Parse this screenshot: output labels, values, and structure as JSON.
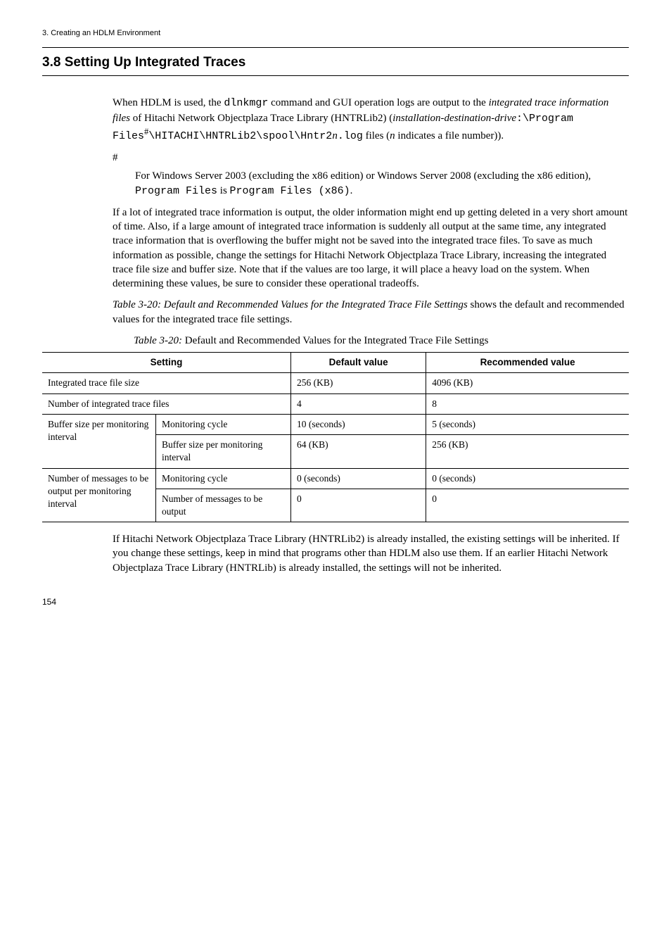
{
  "header": {
    "chapter": "3.  Creating an HDLM Environment"
  },
  "section": {
    "title": "3.8  Setting Up Integrated Traces"
  },
  "intro": {
    "p1_a": "When HDLM is used, the ",
    "p1_cmd": "dlnkmgr",
    "p1_b": " command and GUI operation logs are output to the ",
    "p1_italic1": "integrated trace information files",
    "p1_c": " of Hitachi Network Objectplaza Trace Library (HNTRLib2) (",
    "p1_italic2": "installation-destination-drive",
    "p1_mono1": ":\\Program",
    "p2_mono_prefix": "Files",
    "p2_hash": "#",
    "p2_mono_path_a": "\\HITACHI\\HNTRLib2\\spool\\Hntr2",
    "p2_n": "n",
    "p2_mono_path_b": ".log",
    "p2_d": " files (",
    "p2_italic3": "n",
    "p2_e": " indicates a file number)).",
    "hash": "#",
    "note_a": "For Windows Server 2003 (excluding the x86 edition) or Windows Server 2008 (excluding the x86 edition), ",
    "note_mono1": "Program Files",
    "note_b": " is ",
    "note_mono2": "Program Files (x86)",
    "note_c": "."
  },
  "body": {
    "para1": "If a lot of integrated trace information is output, the older information might end up getting deleted in a very short amount of time. Also, if a large amount of integrated trace information is suddenly all output at the same time, any integrated trace information that is overflowing the buffer might not be saved into the integrated trace files. To save as much information as possible, change the settings for Hitachi Network Objectplaza Trace Library, increasing the integrated trace file size and buffer size. Note that if the values are too large, it will place a heavy load on the system. When determining these values, be sure to consider these operational tradeoffs.",
    "para2_ref": "Table  3-20:  Default and Recommended Values for the Integrated Trace File Settings",
    "para2_tail": " shows the default and recommended values for the integrated trace file settings."
  },
  "table": {
    "caption_ref": "Table  3-20:",
    "caption_text": "  Default and Recommended Values for the Integrated Trace File Settings",
    "headers": {
      "setting": "Setting",
      "default": "Default value",
      "recommended": "Recommended value"
    },
    "rows": {
      "r1": {
        "setting": "Integrated trace file size",
        "default": "256 (KB)",
        "recommended": "4096 (KB)"
      },
      "r2": {
        "setting": "Number of integrated trace files",
        "default": "4",
        "recommended": "8"
      },
      "r3group": "Buffer size per monitoring interval",
      "r3a": {
        "sub": "Monitoring cycle",
        "default": "10 (seconds)",
        "recommended": "5 (seconds)"
      },
      "r3b": {
        "sub": "Buffer size per monitoring interval",
        "default": "64 (KB)",
        "recommended": "256 (KB)"
      },
      "r4group": "Number of messages to be output per monitoring interval",
      "r4a": {
        "sub": "Monitoring cycle",
        "default": "0 (seconds)",
        "recommended": "0 (seconds)"
      },
      "r4b": {
        "sub": "Number of messages to be output",
        "default": "0",
        "recommended": "0"
      }
    }
  },
  "closing": {
    "para": "If Hitachi Network Objectplaza Trace Library (HNTRLib2) is already installed, the existing settings will be inherited. If you change these settings, keep in mind that programs other than HDLM also use them. If an earlier Hitachi Network Objectplaza Trace Library (HNTRLib) is already installed, the settings will not be inherited."
  },
  "page": {
    "number": "154"
  }
}
